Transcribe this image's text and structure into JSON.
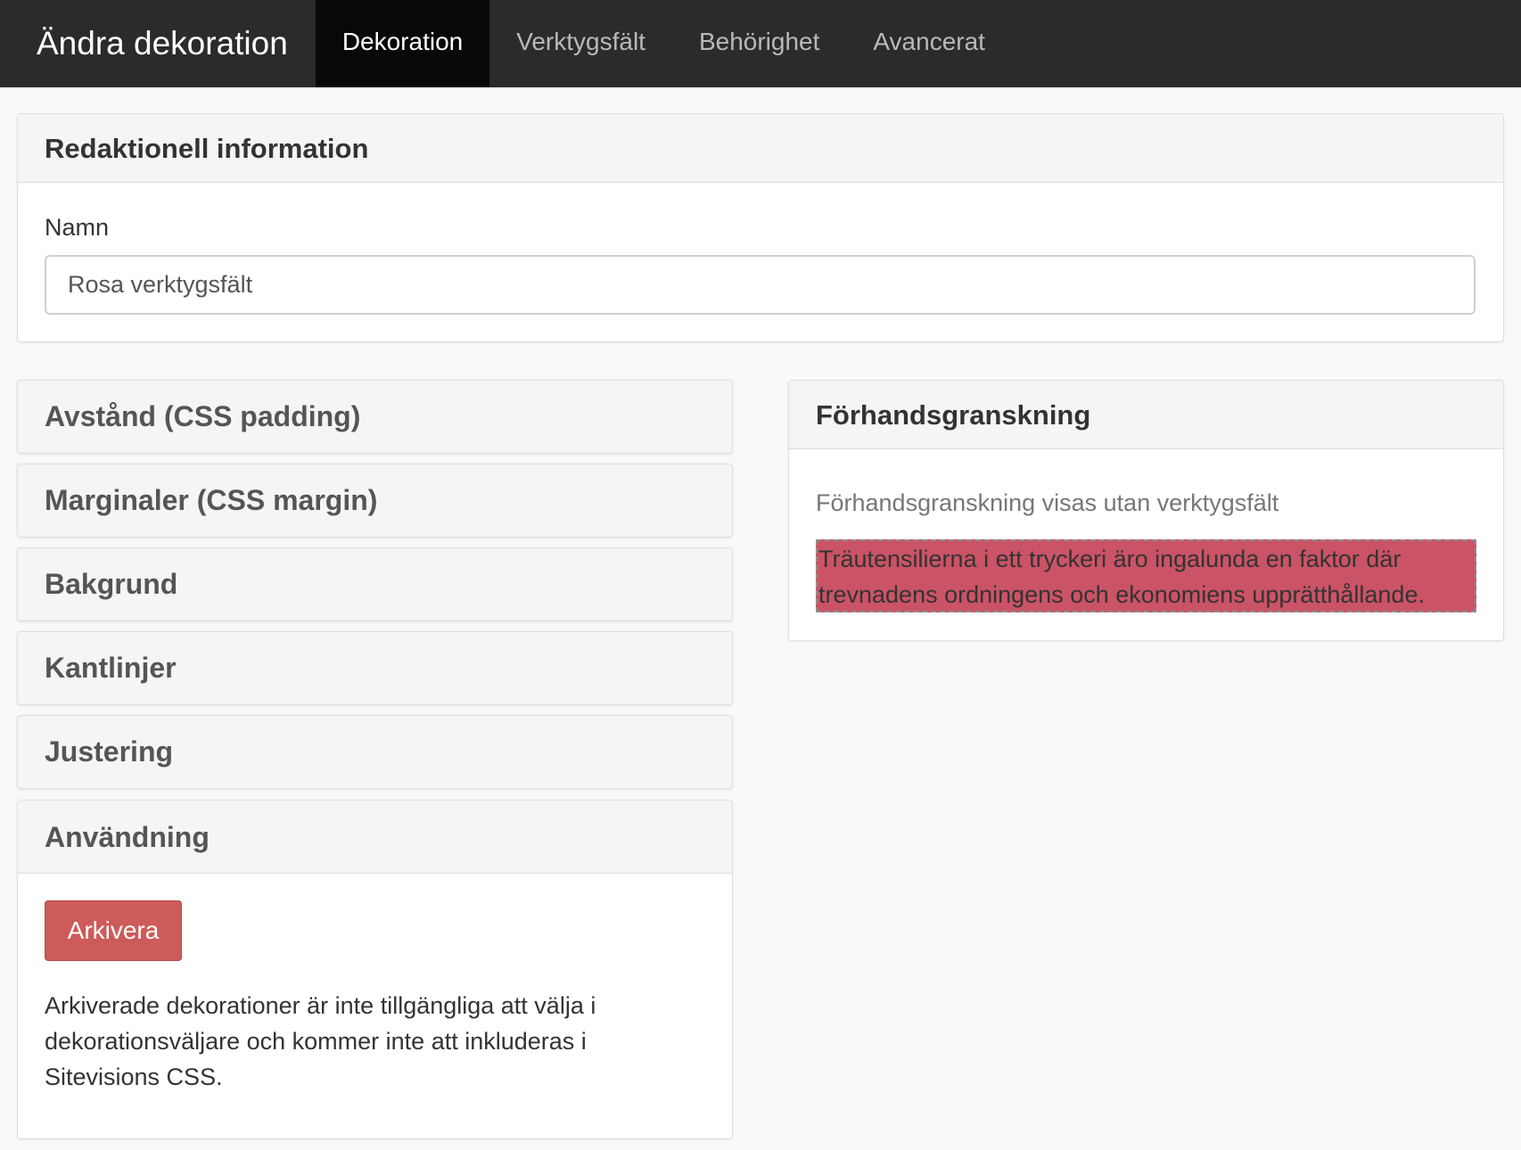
{
  "header": {
    "title": "Ändra dekoration",
    "tabs": [
      {
        "label": "Dekoration",
        "active": true
      },
      {
        "label": "Verktygsfält",
        "active": false
      },
      {
        "label": "Behörighet",
        "active": false
      },
      {
        "label": "Avancerat",
        "active": false
      }
    ]
  },
  "info_panel": {
    "title": "Redaktionell information",
    "name_label": "Namn",
    "name_value": "Rosa verktygsfält"
  },
  "sections": [
    {
      "label": "Avstånd (CSS padding)"
    },
    {
      "label": "Marginaler (CSS margin)"
    },
    {
      "label": "Bakgrund"
    },
    {
      "label": "Kantlinjer"
    },
    {
      "label": "Justering"
    }
  ],
  "usage_panel": {
    "title": "Användning",
    "archive_button": "Arkivera",
    "description": "Arkiverade dekorationer är inte tillgängliga att välja i dekorationsväljare och kommer inte att inkluderas i Sitevisions CSS."
  },
  "preview_panel": {
    "title": "Förhandsgranskning",
    "note": "Förhandsgranskning visas utan verktygsfält",
    "sample_text": "Träutensilierna i ett tryckeri äro ingalunda en faktor där trevnadens ordningens och ekonomiens upprätthållande."
  },
  "colors": {
    "topbar": "#2b2b2b",
    "active_tab": "#080808",
    "archive_button": "#cd5b59",
    "preview_background": "#cb5366"
  }
}
